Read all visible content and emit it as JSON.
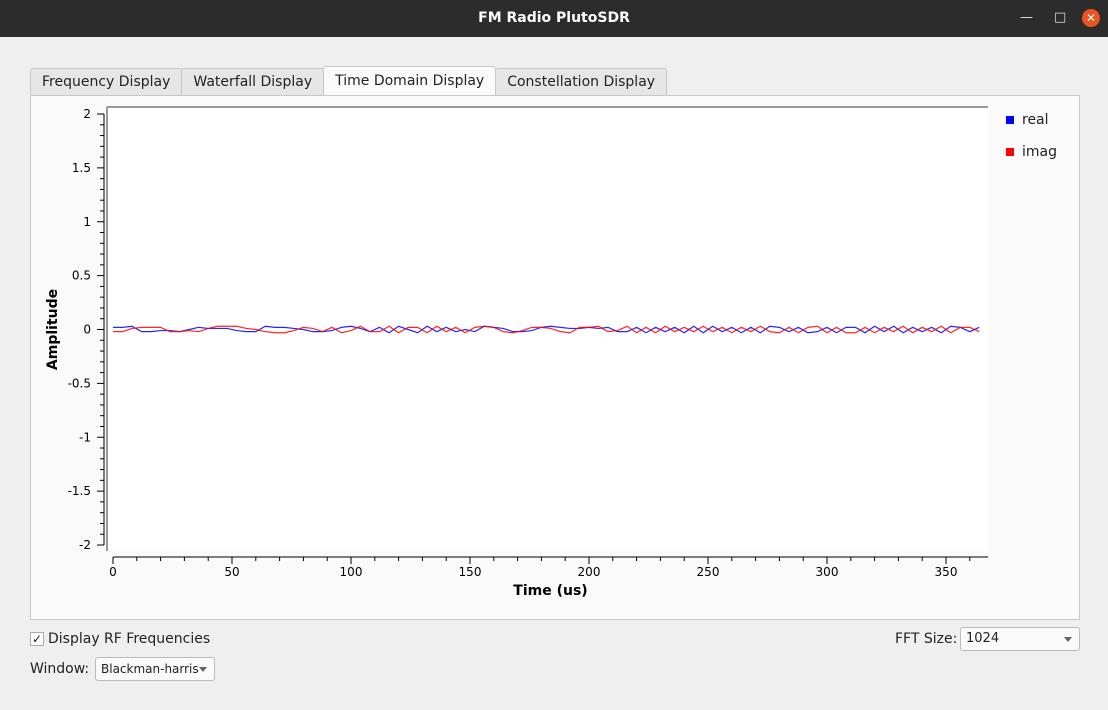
{
  "window": {
    "title": "FM Radio PlutoSDR"
  },
  "tabs": [
    "Frequency Display",
    "Waterfall Display",
    "Time Domain Display",
    "Constellation Display"
  ],
  "active_tab": 2,
  "controls": {
    "display_rf_label": "Display RF Frequencies",
    "display_rf_checked": true,
    "fft_label": "FFT Size:",
    "fft_value": "1024",
    "window_label": "Window:",
    "window_value": "Blackman-harris"
  },
  "colors": {
    "real": "#0000ff",
    "imag": "#ff0000"
  },
  "chart_data": {
    "type": "line",
    "xlabel": "Time (us)",
    "ylabel": "Amplitude",
    "xlim": [
      0,
      366
    ],
    "ylim": [
      -2,
      2
    ],
    "xticks": [
      0,
      50,
      100,
      150,
      200,
      250,
      300,
      350
    ],
    "xtick_labels": [
      "0",
      "50",
      "100",
      "150",
      "200",
      "250",
      "300",
      "350"
    ],
    "yticks": [
      2,
      1.5,
      1,
      0.5,
      0,
      -0.5,
      -1,
      -1.5,
      -2
    ],
    "ytick_labels": [
      "2",
      "1.5",
      "1",
      "0.5",
      "0",
      "-0.5",
      "-1",
      "-1.5",
      "-2"
    ],
    "legend": [
      "real",
      "imag"
    ],
    "legend_position": "right",
    "x_step": 4,
    "series": [
      {
        "name": "real",
        "values": [
          0.02,
          0.02,
          0.03,
          -0.02,
          -0.02,
          -0.01,
          -0.01,
          -0.02,
          0,
          0.02,
          0.01,
          0.01,
          0.01,
          -0.01,
          -0.02,
          -0.02,
          0.03,
          0.02,
          0.02,
          0.01,
          0,
          -0.02,
          -0.02,
          -0.01,
          0.02,
          0.03,
          0.01,
          -0.02,
          0.02,
          -0.03,
          0.03,
          0,
          -0.03,
          0.03,
          -0.02,
          0.02,
          -0.02,
          0,
          -0.02,
          0.03,
          0.02,
          0.01,
          -0.02,
          -0.02,
          -0.01,
          0.02,
          0.03,
          0.02,
          0.01,
          0.01,
          0.02,
          0.01,
          0.02,
          -0.02,
          -0.02,
          0.02,
          -0.03,
          0.02,
          -0.02,
          0.02,
          -0.03,
          0.03,
          -0.03,
          0.03,
          -0.02,
          0.02,
          -0.03,
          0.02,
          -0.03,
          0.03,
          0.02,
          -0.02,
          0.02,
          -0.03,
          -0.02,
          0.02,
          -0.03,
          0.02,
          0.02,
          -0.03,
          0.03,
          -0.02,
          0.03,
          -0.03,
          0.02,
          -0.02,
          0.02,
          -0.03,
          0.03,
          0.02,
          -0.02,
          0.02
        ],
        "color": "#0000ff"
      },
      {
        "name": "imag",
        "values": [
          -0.02,
          -0.02,
          0.01,
          0.02,
          0.02,
          0.02,
          -0.02,
          -0.02,
          -0.01,
          -0.02,
          0.01,
          0.03,
          0.03,
          0.03,
          0.01,
          0,
          -0.02,
          -0.03,
          -0.03,
          -0.01,
          0.02,
          0.01,
          -0.02,
          0.02,
          -0.03,
          -0.01,
          0.03,
          -0.02,
          -0.02,
          0.03,
          -0.03,
          0.02,
          0.02,
          -0.03,
          0.03,
          -0.02,
          0.02,
          -0.03,
          0.02,
          0.03,
          0.02,
          -0.02,
          -0.03,
          -0.01,
          0.02,
          0.02,
          0.01,
          -0.02,
          -0.03,
          0.02,
          0.02,
          0.03,
          -0.02,
          -0.01,
          0.03,
          -0.03,
          0.02,
          -0.03,
          0.03,
          -0.02,
          0.02,
          -0.02,
          0.03,
          -0.02,
          0.02,
          -0.03,
          0.02,
          -0.02,
          0.03,
          -0.02,
          -0.03,
          0.02,
          -0.03,
          0.02,
          0.03,
          -0.03,
          0.02,
          -0.03,
          -0.03,
          0.02,
          -0.03,
          0.02,
          -0.02,
          0.03,
          -0.03,
          0.02,
          -0.02,
          0.03,
          -0.03,
          0.02,
          0.02,
          -0.02
        ],
        "color": "#ff0000"
      }
    ]
  }
}
